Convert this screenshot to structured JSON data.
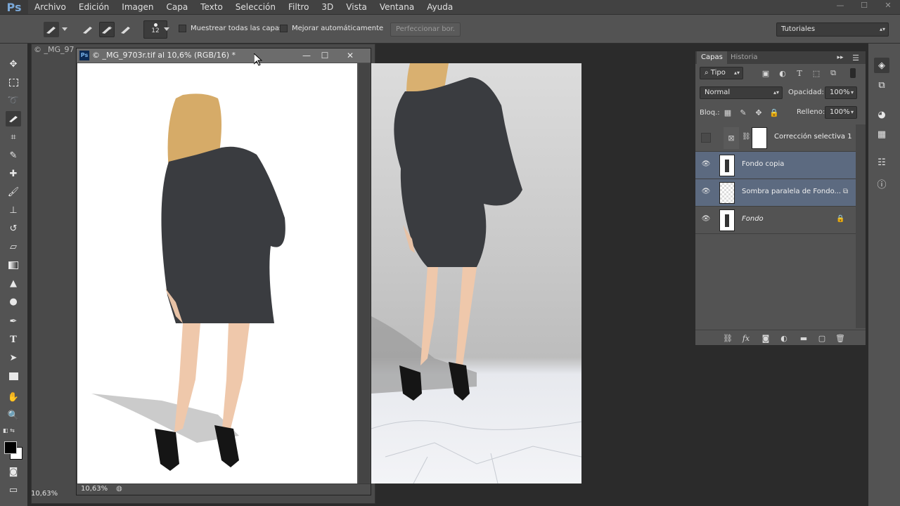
{
  "app": {
    "logo": "Ps"
  },
  "menubar": {
    "items": [
      "Archivo",
      "Edición",
      "Imagen",
      "Capa",
      "Texto",
      "Selección",
      "Filtro",
      "3D",
      "Vista",
      "Ventana",
      "Ayuda"
    ],
    "minimize": "—",
    "maximize": "☐",
    "close": "✕"
  },
  "options": {
    "brush_size": "12",
    "sample_all_layers": "Muestrear todas las capas",
    "auto_enhance": "Mejorar automáticamente",
    "refine_edge": "Perfeccionar bor.",
    "workspace": "Tutoriales"
  },
  "documents": {
    "back_title": "© _MG_97",
    "front_title": "© _MG_9703r.tif al 10,6% (RGB/16) *",
    "front_zoom": "10,63%",
    "back_zoom": "10,63%"
  },
  "layers_panel": {
    "tab_layers": "Capas",
    "tab_history": "Historia",
    "filter_kind": "Tipo",
    "blend_mode": "Normal",
    "opacity_label": "Opacidad:",
    "opacity_value": "100%",
    "lock_label": "Bloq.:",
    "fill_label": "Relleno:",
    "fill_value": "100%",
    "layers": [
      {
        "name": "Corrección selectiva 1",
        "visible": false,
        "selected": false
      },
      {
        "name": "Fondo copia",
        "visible": true,
        "selected": true
      },
      {
        "name": "Sombra paralela de Fondo...",
        "visible": true,
        "selected": true
      },
      {
        "name": "Fondo",
        "visible": true,
        "selected": false
      }
    ]
  },
  "colors": {
    "accent_selected": "#5c6a80",
    "panel_bg": "#535353",
    "app_bg": "#2b2b2b"
  }
}
